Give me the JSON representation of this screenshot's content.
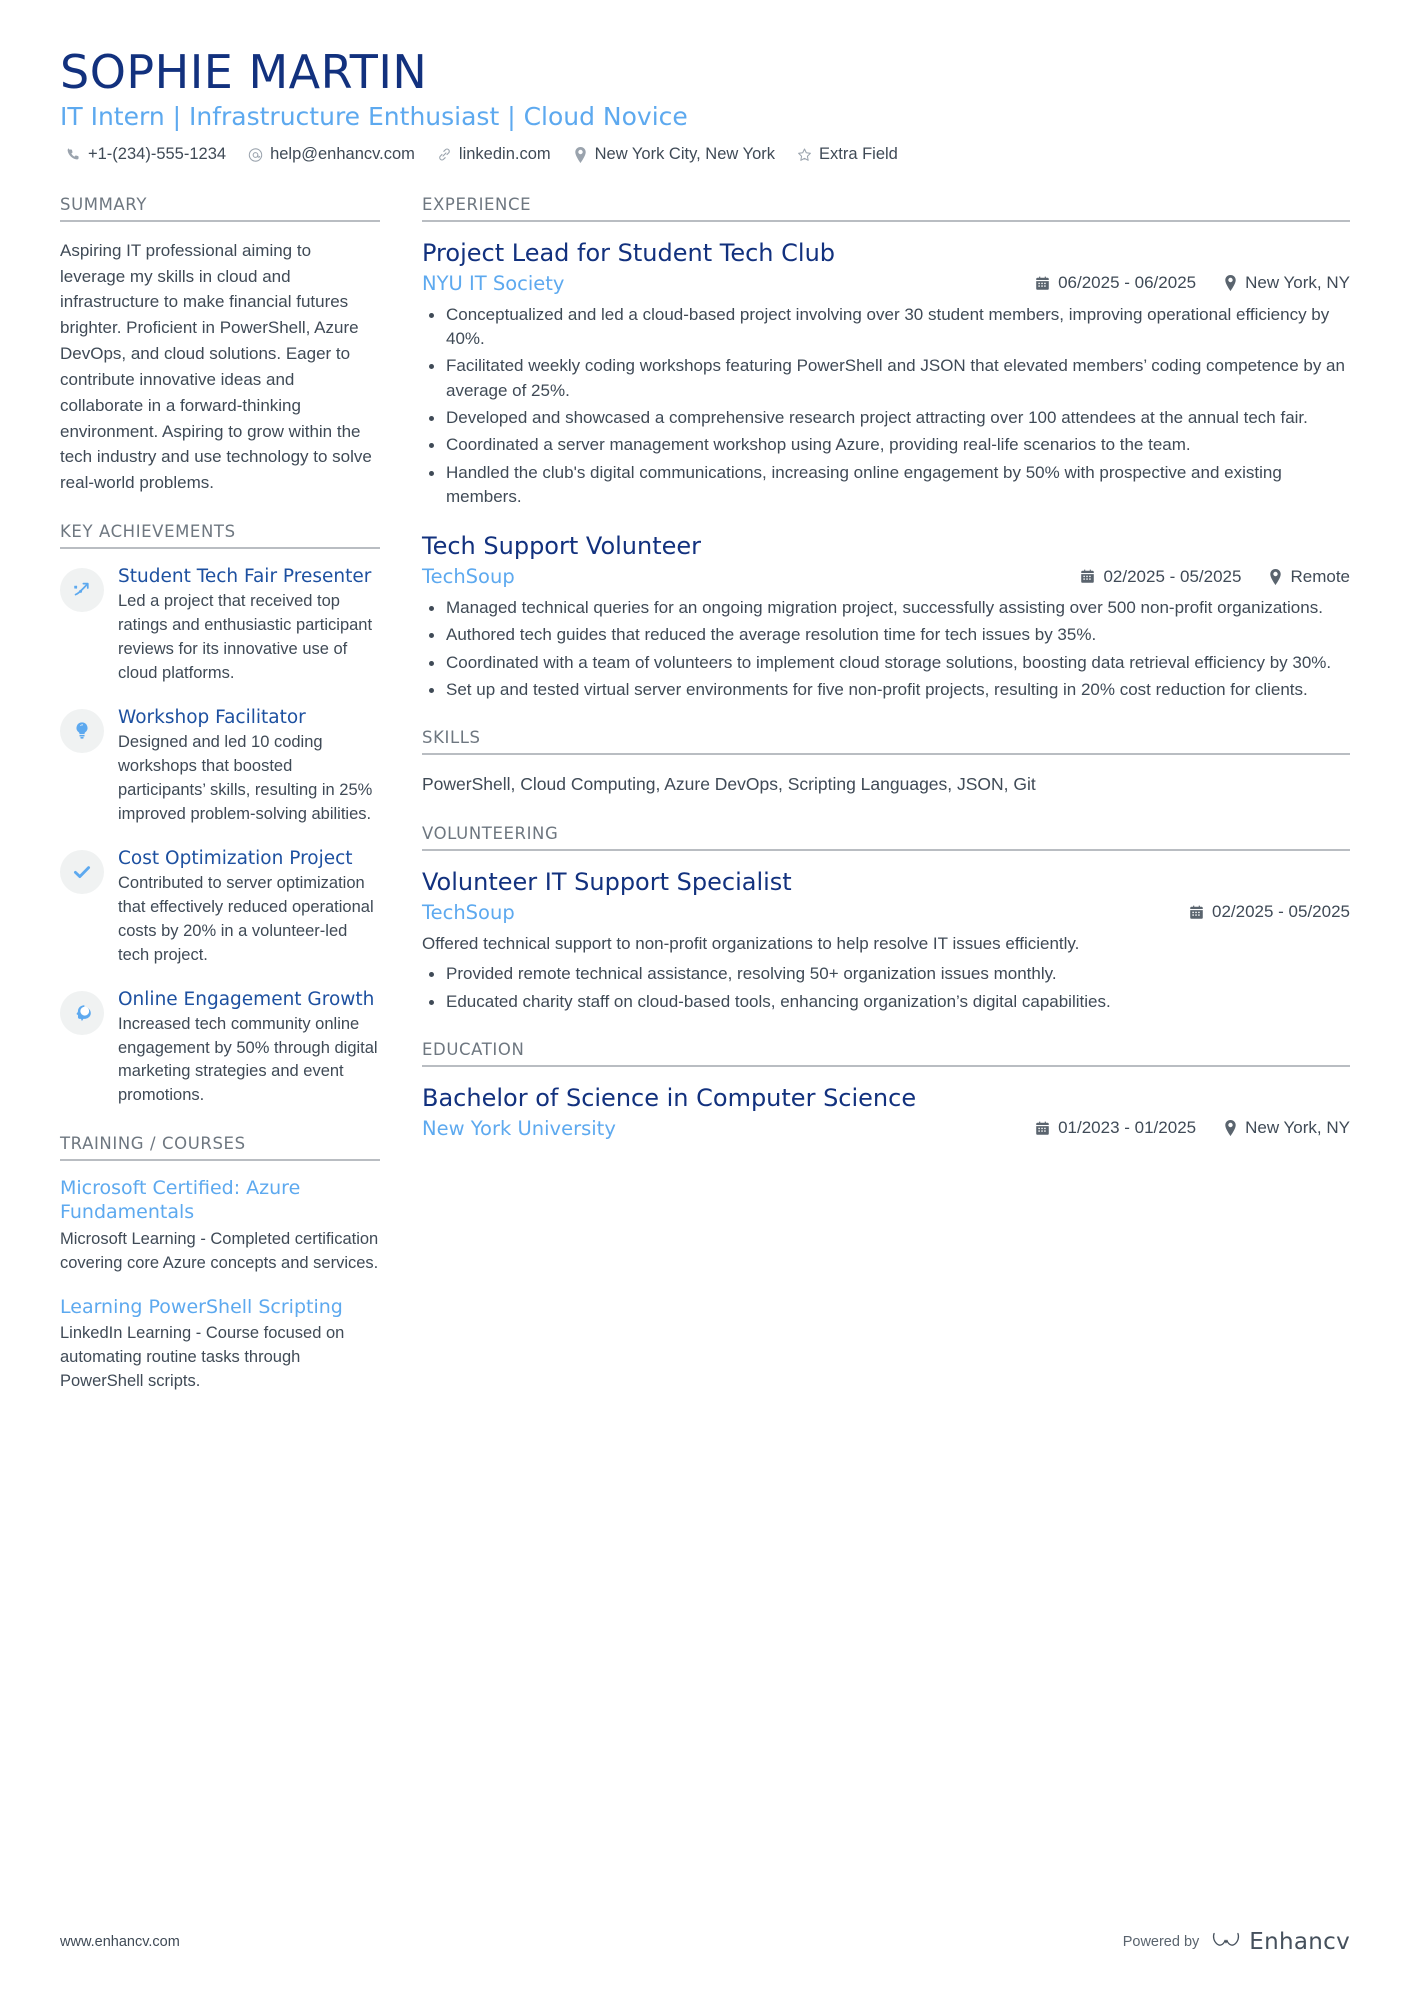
{
  "header": {
    "name": "SOPHIE MARTIN",
    "role": "IT Intern | Infrastructure Enthusiast | Cloud Novice",
    "contacts": [
      {
        "icon": "phone-icon",
        "text": "+1-(234)-555-1234"
      },
      {
        "icon": "email-icon",
        "text": "help@enhancv.com"
      },
      {
        "icon": "link-icon",
        "text": "linkedin.com"
      },
      {
        "icon": "location-pin-icon",
        "text": "New York City, New York"
      },
      {
        "icon": "star-icon",
        "text": "Extra Field"
      }
    ]
  },
  "colors": {
    "name_navy": "#12317e",
    "accent_blue": "#5da9ef",
    "entry_navy": "#12317e",
    "body_text": "#3f4a56",
    "section_title": "#6e7780",
    "rule": "#b9bdc2",
    "icon_circle_bg": "#f0f2f2"
  },
  "left": {
    "summary": {
      "title": "SUMMARY",
      "text": "Aspiring IT professional aiming to leverage my skills in cloud and infrastructure to make financial futures brighter. Proficient in PowerShell, Azure DevOps, and cloud solutions. Eager to contribute innovative ideas and collaborate in a forward-thinking environment. Aspiring to grow within the tech industry and use technology to solve real-world problems."
    },
    "achievements": {
      "title": "KEY ACHIEVEMENTS",
      "items": [
        {
          "icon": "trend-up-arrow-icon",
          "title": "Student Tech Fair Presenter",
          "desc": "Led a project that received top ratings and enthusiastic participant reviews for its innovative use of cloud platforms."
        },
        {
          "icon": "lightbulb-icon",
          "title": "Workshop Facilitator",
          "desc": "Designed and led 10 coding workshops that boosted participants’ skills, resulting in 25% improved problem-solving abilities."
        },
        {
          "icon": "checkmark-icon",
          "title": "Cost Optimization Project",
          "desc": "Contributed to server optimization that effectively reduced operational costs by 20% in a volunteer-led tech project."
        },
        {
          "icon": "head-thought-icon",
          "title": "Online Engagement Growth",
          "desc": "Increased tech community online engagement by 50% through digital marketing strategies and event promotions."
        }
      ]
    },
    "training": {
      "title": "TRAINING / COURSES",
      "items": [
        {
          "title": "Microsoft Certified: Azure Fundamentals",
          "desc": "Microsoft Learning - Completed certification covering core Azure concepts and services."
        },
        {
          "title": "Learning PowerShell Scripting",
          "desc": "LinkedIn Learning - Course focused on automating routine tasks through PowerShell scripts."
        }
      ]
    }
  },
  "right": {
    "experience": {
      "title": "EXPERIENCE",
      "entries": [
        {
          "title": "Project Lead for Student Tech Club",
          "org": "NYU IT Society",
          "date": "06/2025 - 06/2025",
          "location": "New York, NY",
          "bullets": [
            "Conceptualized and led a cloud-based project involving over 30 student members, improving operational efficiency by 40%.",
            "Facilitated weekly coding workshops featuring PowerShell and JSON that elevated members’ coding competence by an average of 25%.",
            "Developed and showcased a comprehensive research project attracting over 100 attendees at the annual tech fair.",
            "Coordinated a server management workshop using Azure, providing real-life scenarios to the team.",
            "Handled the club's digital communications, increasing online engagement by 50% with prospective and existing members."
          ]
        },
        {
          "title": "Tech Support Volunteer",
          "org": "TechSoup",
          "date": "02/2025 - 05/2025",
          "location": "Remote",
          "bullets": [
            "Managed technical queries for an ongoing migration project, successfully assisting over 500 non-profit organizations.",
            "Authored tech guides that reduced the average resolution time for tech issues by 35%.",
            "Coordinated with a team of volunteers to implement cloud storage solutions, boosting data retrieval efficiency by 30%.",
            "Set up and tested virtual server environments for five non-profit projects, resulting in 20% cost reduction for clients."
          ]
        }
      ]
    },
    "skills": {
      "title": "SKILLS",
      "text": "PowerShell, Cloud Computing, Azure DevOps, Scripting Languages, JSON, Git"
    },
    "volunteering": {
      "title": "VOLUNTEERING",
      "entries": [
        {
          "title": "Volunteer IT Support Specialist",
          "org": "TechSoup",
          "date": "02/2025 - 05/2025",
          "location": "",
          "intro": "Offered technical support to non-profit organizations to help resolve IT issues efficiently.",
          "bullets": [
            "Provided remote technical assistance, resolving 50+ organization issues monthly.",
            "Educated charity staff on cloud-based tools, enhancing organization’s digital capabilities."
          ]
        }
      ]
    },
    "education": {
      "title": "EDUCATION",
      "entries": [
        {
          "title": "Bachelor of Science in Computer Science",
          "org": "New York University",
          "date": "01/2023 - 01/2025",
          "location": "New York, NY"
        }
      ]
    }
  },
  "footer": {
    "url": "www.enhancv.com",
    "powered_by": "Powered by",
    "brand": "Enhancv"
  }
}
